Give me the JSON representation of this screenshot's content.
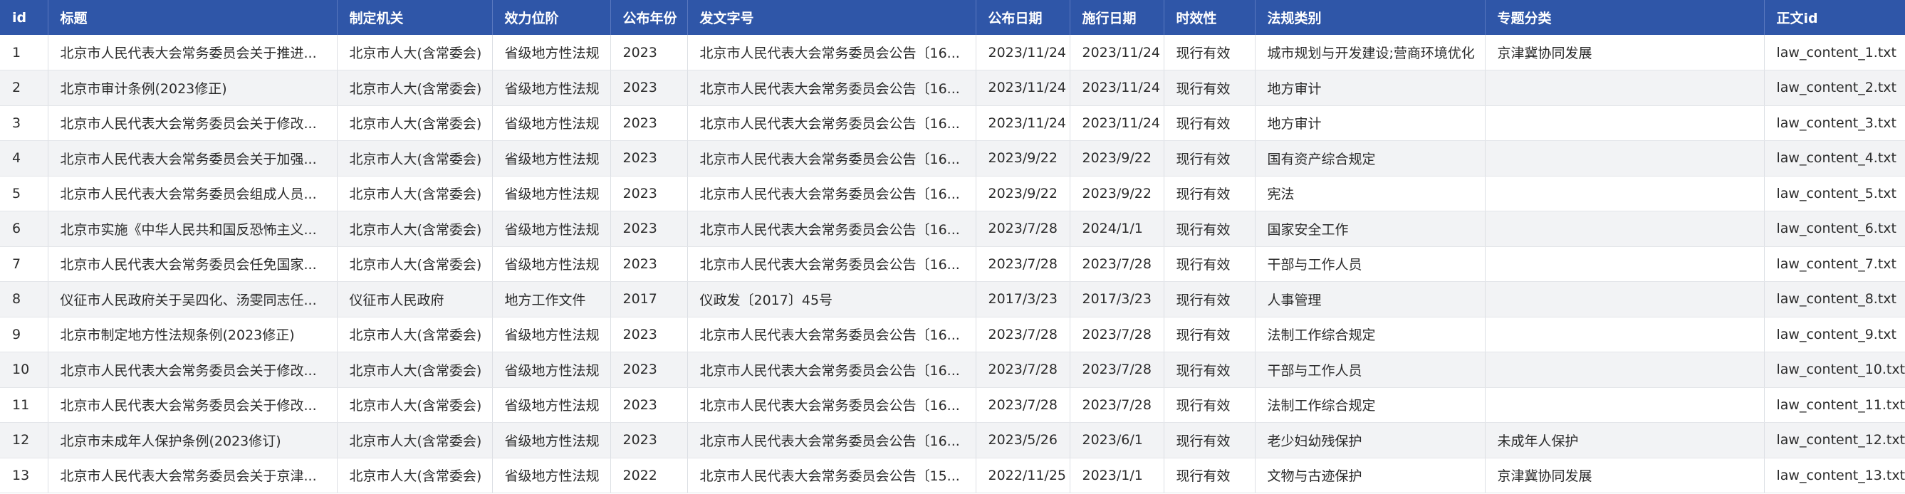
{
  "table": {
    "columns": [
      "id",
      "标题",
      "制定机关",
      "效力位阶",
      "公布年份",
      "发文字号",
      "公布日期",
      "施行日期",
      "时效性",
      "法规类别",
      "专题分类",
      "正文id"
    ],
    "rows": [
      [
        "1",
        "北京市人民代表大会常务委员会关于推进...",
        "北京市人大(含常委会)",
        "省级地方性法规",
        "2023",
        "北京市人民代表大会常务委员会公告〔16...",
        "2023/11/24",
        "2023/11/24",
        "现行有效",
        "城市规划与开发建设;营商环境优化",
        "京津冀协同发展",
        "law_content_1.txt"
      ],
      [
        "2",
        "北京市审计条例(2023修正)",
        "北京市人大(含常委会)",
        "省级地方性法规",
        "2023",
        "北京市人民代表大会常务委员会公告〔16...",
        "2023/11/24",
        "2023/11/24",
        "现行有效",
        "地方审计",
        "",
        "law_content_2.txt"
      ],
      [
        "3",
        "北京市人民代表大会常务委员会关于修改...",
        "北京市人大(含常委会)",
        "省级地方性法规",
        "2023",
        "北京市人民代表大会常务委员会公告〔16...",
        "2023/11/24",
        "2023/11/24",
        "现行有效",
        "地方审计",
        "",
        "law_content_3.txt"
      ],
      [
        "4",
        "北京市人民代表大会常务委员会关于加强...",
        "北京市人大(含常委会)",
        "省级地方性法规",
        "2023",
        "北京市人民代表大会常务委员会公告〔16...",
        "2023/9/22",
        "2023/9/22",
        "现行有效",
        "国有资产综合规定",
        "",
        "law_content_4.txt"
      ],
      [
        "5",
        "北京市人民代表大会常务委员会组成人员...",
        "北京市人大(含常委会)",
        "省级地方性法规",
        "2023",
        "北京市人民代表大会常务委员会公告〔16...",
        "2023/9/22",
        "2023/9/22",
        "现行有效",
        "宪法",
        "",
        "law_content_5.txt"
      ],
      [
        "6",
        "北京市实施《中华人民共和国反恐怖主义...",
        "北京市人大(含常委会)",
        "省级地方性法规",
        "2023",
        "北京市人民代表大会常务委员会公告〔16...",
        "2023/7/28",
        "2024/1/1",
        "现行有效",
        "国家安全工作",
        "",
        "law_content_6.txt"
      ],
      [
        "7",
        "北京市人民代表大会常务委员会任免国家...",
        "北京市人大(含常委会)",
        "省级地方性法规",
        "2023",
        "北京市人民代表大会常务委员会公告〔16...",
        "2023/7/28",
        "2023/7/28",
        "现行有效",
        "干部与工作人员",
        "",
        "law_content_7.txt"
      ],
      [
        "8",
        "仪征市人民政府关于吴四化、汤雯同志任...",
        "仪征市人民政府",
        "地方工作文件",
        "2017",
        "仪政发〔2017〕45号",
        "2017/3/23",
        "2017/3/23",
        "现行有效",
        "人事管理",
        "",
        "law_content_8.txt"
      ],
      [
        "9",
        "北京市制定地方性法规条例(2023修正)",
        "北京市人大(含常委会)",
        "省级地方性法规",
        "2023",
        "北京市人民代表大会常务委员会公告〔16...",
        "2023/7/28",
        "2023/7/28",
        "现行有效",
        "法制工作综合规定",
        "",
        "law_content_9.txt"
      ],
      [
        "10",
        "北京市人民代表大会常务委员会关于修改...",
        "北京市人大(含常委会)",
        "省级地方性法规",
        "2023",
        "北京市人民代表大会常务委员会公告〔16...",
        "2023/7/28",
        "2023/7/28",
        "现行有效",
        "干部与工作人员",
        "",
        "law_content_10.txt"
      ],
      [
        "11",
        "北京市人民代表大会常务委员会关于修改...",
        "北京市人大(含常委会)",
        "省级地方性法规",
        "2023",
        "北京市人民代表大会常务委员会公告〔16...",
        "2023/7/28",
        "2023/7/28",
        "现行有效",
        "法制工作综合规定",
        "",
        "law_content_11.txt"
      ],
      [
        "12",
        "北京市未成年人保护条例(2023修订)",
        "北京市人大(含常委会)",
        "省级地方性法规",
        "2023",
        "北京市人民代表大会常务委员会公告〔16...",
        "2023/5/26",
        "2023/6/1",
        "现行有效",
        "老少妇幼残保护",
        "未成年人保护",
        "law_content_12.txt"
      ],
      [
        "13",
        "北京市人民代表大会常务委员会关于京津...",
        "北京市人大(含常委会)",
        "省级地方性法规",
        "2022",
        "北京市人民代表大会常务委员会公告〔15...",
        "2022/11/25",
        "2023/1/1",
        "现行有效",
        "文物与古迹保护",
        "京津冀协同发展",
        "law_content_13.txt"
      ]
    ]
  }
}
